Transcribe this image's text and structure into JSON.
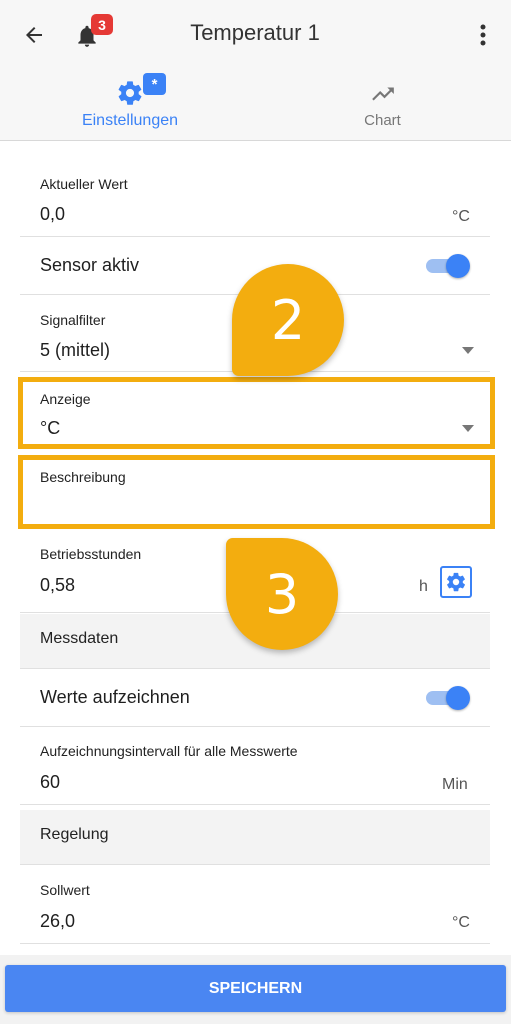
{
  "header": {
    "title": "Temperatur 1",
    "notification_count": "3"
  },
  "tabs": [
    {
      "label": "Einstellungen",
      "badge": "*",
      "icon": "gear-icon",
      "active": true
    },
    {
      "label": "Chart",
      "icon": "trending-up-icon",
      "active": false
    }
  ],
  "fields": {
    "current_value": {
      "label": "Aktueller Wert",
      "value": "0,0",
      "unit": "°C"
    },
    "sensor_active": {
      "label": "Sensor aktiv",
      "on": true
    },
    "signal_filter": {
      "label": "Signalfilter",
      "value": "5 (mittel)"
    },
    "display": {
      "label": "Anzeige",
      "value": "°C"
    },
    "description": {
      "label": "Beschreibung",
      "value": ""
    },
    "operating_hours": {
      "label": "Betriebsstunden",
      "value": "0,58",
      "unit": "h"
    }
  },
  "sections": {
    "measurement": {
      "title": "Messdaten",
      "record_values": {
        "label": "Werte aufzeichnen",
        "on": true
      },
      "interval": {
        "label": "Aufzeichnungsintervall für alle Messwerte",
        "value": "60",
        "unit": "Min"
      }
    },
    "control": {
      "title": "Regelung",
      "setpoint": {
        "label": "Sollwert",
        "value": "26,0",
        "unit": "°C"
      }
    }
  },
  "annotations": {
    "bubble_1": "2",
    "bubble_2": "3"
  },
  "footer": {
    "save_label": "SPEICHERN"
  },
  "colors": {
    "accent": "#3b82f6",
    "highlight": "#f3ad0f",
    "badge": "#e53935"
  }
}
